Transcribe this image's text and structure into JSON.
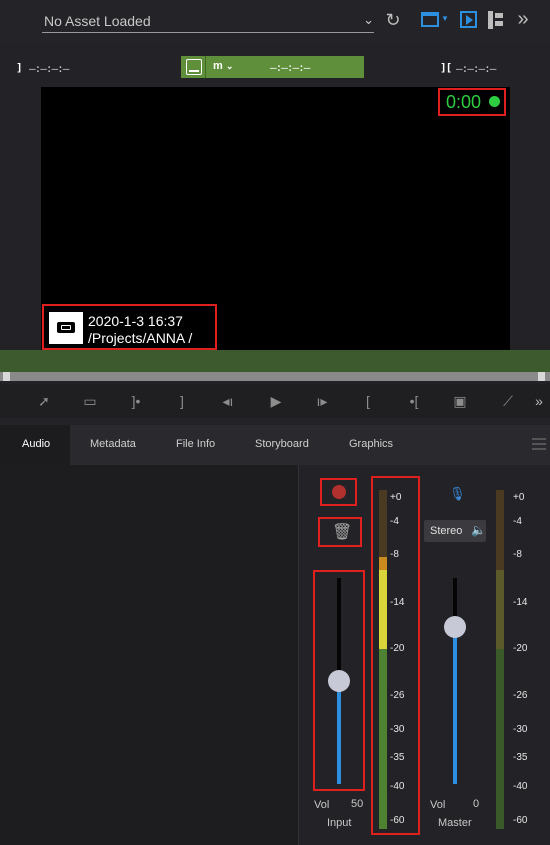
{
  "top": {
    "asset_title": "No Asset Loaded",
    "icons": [
      "chevron-down-icon",
      "refresh-icon",
      "layout-icon",
      "player-icon",
      "tree-icon",
      "double-chevron-right-icon"
    ]
  },
  "timecodes": {
    "in_point": "—:—:—:—",
    "mid": "—:—:—:—",
    "out_point": "—:—:—:—",
    "mode": "m"
  },
  "player": {
    "time": "0:00",
    "status_color": "#2ecc40",
    "info_date": "2020-1-3 16:37",
    "info_path": "/Projects/ANNA /"
  },
  "transport": {
    "icons": [
      "send-icon",
      "filmstrip-icon",
      "mark-in-icon",
      "bracket-right-icon",
      "step-back-icon",
      "play-icon",
      "step-forward-icon",
      "bracket-left-icon",
      "goto-in-icon",
      "frame-icon",
      "wand-icon",
      "more-icon"
    ]
  },
  "tabs": [
    {
      "label": "Audio"
    },
    {
      "label": "Metadata"
    },
    {
      "label": "File Info"
    },
    {
      "label": "Storyboard"
    },
    {
      "label": "Graphics"
    }
  ],
  "audio": {
    "input": {
      "vol_label": "Vol",
      "vol_value": "50",
      "name": "Input",
      "level_pct": 50
    },
    "master": {
      "vol_label": "Vol",
      "vol_value": "0",
      "name": "Master",
      "mode": "Stereo"
    },
    "scale": [
      "+0",
      "-4",
      "-8",
      "-14",
      "-20",
      "-26",
      "-30",
      "-35",
      "-40",
      "-60"
    ],
    "colors": {
      "accent": "#2d8fe0",
      "record": "#b0312d",
      "highlight": "#e0201f"
    }
  }
}
